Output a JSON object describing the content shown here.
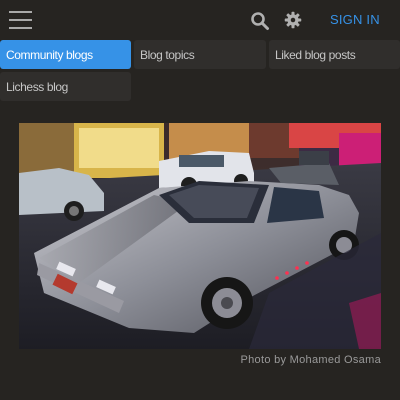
{
  "header": {
    "signin_label": "SIGN IN",
    "accent_color": "#3692e7"
  },
  "icons": {
    "menu": "hamburger-menu-icon",
    "search": "search-icon",
    "settings": "gear-icon"
  },
  "tabs": [
    {
      "label": "Community blogs",
      "active": true
    },
    {
      "label": "Blog topics",
      "active": false
    },
    {
      "label": "Liked blog posts",
      "active": false
    },
    {
      "label": "Lichess blog",
      "active": false
    }
  ],
  "hero": {
    "caption": "Photo by Mohamed Osama"
  }
}
